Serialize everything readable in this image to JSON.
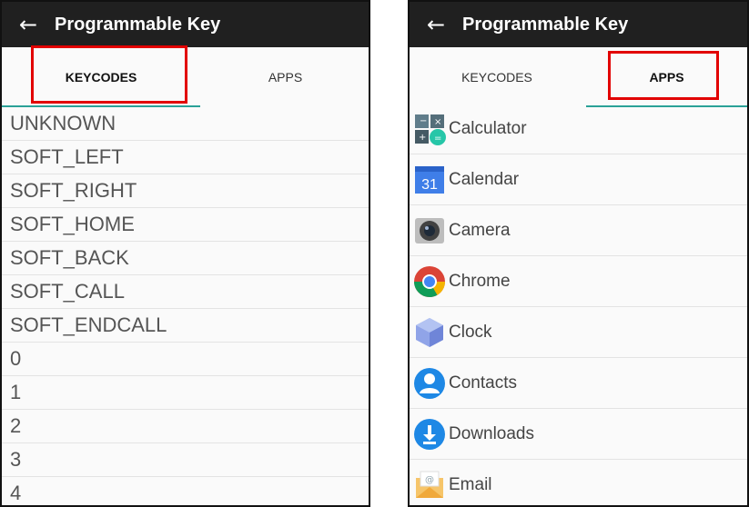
{
  "left": {
    "header": {
      "title": "Programmable Key",
      "back_icon": "arrow-left-icon"
    },
    "tabs": [
      {
        "label": "KEYCODES",
        "active": true
      },
      {
        "label": "APPS",
        "active": false
      }
    ],
    "keycodes": [
      "UNKNOWN",
      "SOFT_LEFT",
      "SOFT_RIGHT",
      "SOFT_HOME",
      "SOFT_BACK",
      "SOFT_CALL",
      "SOFT_ENDCALL",
      "0",
      "1",
      "2",
      "3",
      "4"
    ]
  },
  "right": {
    "header": {
      "title": "Programmable Key",
      "back_icon": "arrow-left-icon"
    },
    "tabs": [
      {
        "label": "KEYCODES",
        "active": false
      },
      {
        "label": "APPS",
        "active": true
      }
    ],
    "apps": [
      {
        "label": "Calculator",
        "icon": "calculator-icon"
      },
      {
        "label": "Calendar",
        "icon": "calendar-icon",
        "icon_text": "31"
      },
      {
        "label": "Camera",
        "icon": "camera-icon"
      },
      {
        "label": "Chrome",
        "icon": "chrome-icon"
      },
      {
        "label": "Clock",
        "icon": "clock-icon"
      },
      {
        "label": "Contacts",
        "icon": "contacts-icon"
      },
      {
        "label": "Downloads",
        "icon": "downloads-icon"
      },
      {
        "label": "Email",
        "icon": "email-icon"
      }
    ]
  },
  "colors": {
    "appbar": "#202020",
    "tab_indicator": "#2aa197",
    "highlight": "#e20000"
  }
}
